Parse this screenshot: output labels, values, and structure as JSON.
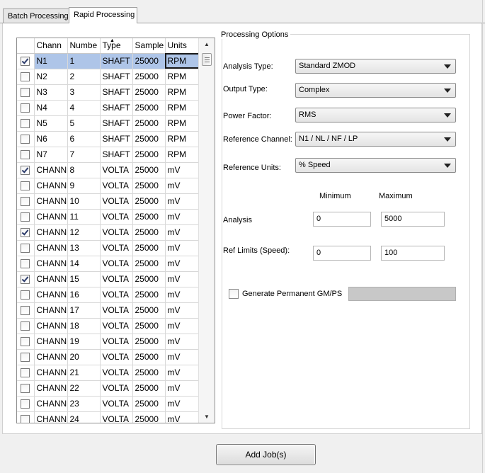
{
  "tabs": [
    {
      "label": "Batch Processing",
      "active": false
    },
    {
      "label": "Rapid Processing",
      "active": true
    }
  ],
  "grid": {
    "columns": [
      "Chann",
      "Numbe",
      "Type",
      "Sample",
      "Units"
    ],
    "sorted_column": "Numbe",
    "rows": [
      {
        "checked": true,
        "channel": "N1",
        "number": "1",
        "type": "SHAFT",
        "sample": "25000",
        "units": "RPM",
        "selected": true
      },
      {
        "checked": false,
        "channel": "N2",
        "number": "2",
        "type": "SHAFT",
        "sample": "25000",
        "units": "RPM"
      },
      {
        "checked": false,
        "channel": "N3",
        "number": "3",
        "type": "SHAFT",
        "sample": "25000",
        "units": "RPM"
      },
      {
        "checked": false,
        "channel": "N4",
        "number": "4",
        "type": "SHAFT",
        "sample": "25000",
        "units": "RPM"
      },
      {
        "checked": false,
        "channel": "N5",
        "number": "5",
        "type": "SHAFT",
        "sample": "25000",
        "units": "RPM"
      },
      {
        "checked": false,
        "channel": "N6",
        "number": "6",
        "type": "SHAFT",
        "sample": "25000",
        "units": "RPM"
      },
      {
        "checked": false,
        "channel": "N7",
        "number": "7",
        "type": "SHAFT",
        "sample": "25000",
        "units": "RPM"
      },
      {
        "checked": true,
        "channel": "CHANN",
        "number": "8",
        "type": "VOLTA",
        "sample": "25000",
        "units": "mV"
      },
      {
        "checked": false,
        "channel": "CHANN",
        "number": "9",
        "type": "VOLTA",
        "sample": "25000",
        "units": "mV"
      },
      {
        "checked": false,
        "channel": "CHANN",
        "number": "10",
        "type": "VOLTA",
        "sample": "25000",
        "units": "mV"
      },
      {
        "checked": false,
        "channel": "CHANN",
        "number": "11",
        "type": "VOLTA",
        "sample": "25000",
        "units": "mV"
      },
      {
        "checked": true,
        "channel": "CHANN",
        "number": "12",
        "type": "VOLTA",
        "sample": "25000",
        "units": "mV"
      },
      {
        "checked": false,
        "channel": "CHANN",
        "number": "13",
        "type": "VOLTA",
        "sample": "25000",
        "units": "mV"
      },
      {
        "checked": false,
        "channel": "CHANN",
        "number": "14",
        "type": "VOLTA",
        "sample": "25000",
        "units": "mV"
      },
      {
        "checked": true,
        "channel": "CHANN",
        "number": "15",
        "type": "VOLTA",
        "sample": "25000",
        "units": "mV"
      },
      {
        "checked": false,
        "channel": "CHANN",
        "number": "16",
        "type": "VOLTA",
        "sample": "25000",
        "units": "mV"
      },
      {
        "checked": false,
        "channel": "CHANN",
        "number": "17",
        "type": "VOLTA",
        "sample": "25000",
        "units": "mV"
      },
      {
        "checked": false,
        "channel": "CHANN",
        "number": "18",
        "type": "VOLTA",
        "sample": "25000",
        "units": "mV"
      },
      {
        "checked": false,
        "channel": "CHANN",
        "number": "19",
        "type": "VOLTA",
        "sample": "25000",
        "units": "mV"
      },
      {
        "checked": false,
        "channel": "CHANN",
        "number": "20",
        "type": "VOLTA",
        "sample": "25000",
        "units": "mV"
      },
      {
        "checked": false,
        "channel": "CHANN",
        "number": "21",
        "type": "VOLTA",
        "sample": "25000",
        "units": "mV"
      },
      {
        "checked": false,
        "channel": "CHANN",
        "number": "22",
        "type": "VOLTA",
        "sample": "25000",
        "units": "mV"
      },
      {
        "checked": false,
        "channel": "CHANN",
        "number": "23",
        "type": "VOLTA",
        "sample": "25000",
        "units": "mV"
      },
      {
        "checked": false,
        "channel": "CHANN",
        "number": "24",
        "type": "VOLTA",
        "sample": "25000",
        "units": "mV"
      }
    ]
  },
  "options": {
    "group_title": "Processing Options",
    "analysis_type": {
      "label": "Analysis Type:",
      "value": "Standard ZMOD"
    },
    "output_type": {
      "label": "Output Type:",
      "value": "Complex"
    },
    "power_factor": {
      "label": "Power Factor:",
      "value": "RMS"
    },
    "reference_channel": {
      "label": "Reference Channel:",
      "value": "N1 / NL / NF / LP"
    },
    "reference_units": {
      "label": "Reference Units:",
      "value": "% Speed"
    },
    "minimum_label": "Minimum",
    "maximum_label": "Maximum",
    "analysis": {
      "label": "Analysis",
      "min": "0",
      "max": "5000"
    },
    "ref_limits": {
      "label": "Ref Limits (Speed):",
      "min": "0",
      "max": "100"
    },
    "generate": {
      "label": "Generate Permanent GM/PS",
      "checked": false
    }
  },
  "add_button": "Add Job(s)"
}
